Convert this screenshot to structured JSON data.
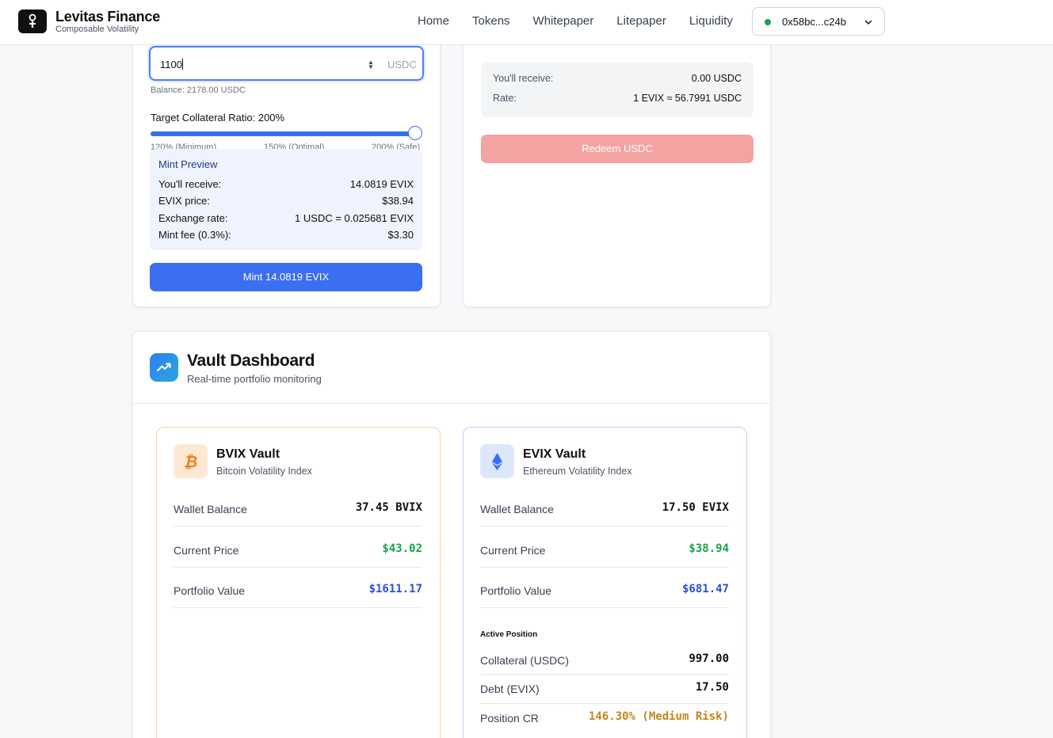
{
  "header": {
    "brand_name": "Levitas Finance",
    "brand_sub": "Composable Volatility",
    "nav": [
      "Home",
      "Tokens",
      "Whitepaper",
      "Litepaper",
      "Liquidity"
    ],
    "wallet_address": "0x58bc...c24b",
    "wallet_status_color": "#16a34a"
  },
  "mint": {
    "amount_value": "1100",
    "amount_unit": "USDC",
    "balance": "Balance: 2178.00 USDC",
    "ratio_label": "Target Collateral Ratio: 200%",
    "ratio_value_percent": 200,
    "ticks": [
      "120% (Minimum)",
      "150% (Optimal)",
      "200% (Safe)"
    ],
    "preview": {
      "title": "Mint Preview",
      "rows": [
        {
          "label": "You'll receive:",
          "value": "14.0819 EVIX"
        },
        {
          "label": "EVIX price:",
          "value": "$38.94"
        },
        {
          "label": "Exchange rate:",
          "value": "1 USDC = 0.025681 EVIX"
        },
        {
          "label": "Mint fee (0.3%):",
          "value": "$3.30"
        }
      ]
    },
    "button_label": "Mint 14.0819 EVIX"
  },
  "redeem": {
    "rows": [
      {
        "label": "You'll receive:",
        "value": "0.00 USDC"
      },
      {
        "label": "Rate:",
        "value": "1 EVIX ≈ 56.7991 USDC"
      }
    ],
    "button_label": "Redeem USDC"
  },
  "dashboard": {
    "title": "Vault Dashboard",
    "subtitle": "Real-time portfolio monitoring",
    "icon": "trending-up-icon",
    "vaults": [
      {
        "name": "BVIX Vault",
        "desc": "Bitcoin Volatility Index",
        "icon": "bitcoin-icon",
        "rows": [
          {
            "label": "Wallet Balance",
            "value": "37.45 BVIX"
          },
          {
            "label": "Current Price",
            "value": "$43.02"
          },
          {
            "label": "Portfolio Value",
            "value": "$1611.17"
          }
        ]
      },
      {
        "name": "EVIX Vault",
        "desc": "Ethereum Volatility Index",
        "icon": "ethereum-icon",
        "rows": [
          {
            "label": "Wallet Balance",
            "value": "17.50 EVIX"
          },
          {
            "label": "Current Price",
            "value": "$38.94"
          },
          {
            "label": "Portfolio Value",
            "value": "$681.47"
          }
        ],
        "active_position_title": "Active Position",
        "position_rows": [
          {
            "label": "Collateral (USDC)",
            "value": "997.00"
          },
          {
            "label": "Debt (EVIX)",
            "value": "17.50"
          },
          {
            "label": "Position CR",
            "value": "146.30% (Medium Risk)"
          }
        ]
      }
    ]
  }
}
